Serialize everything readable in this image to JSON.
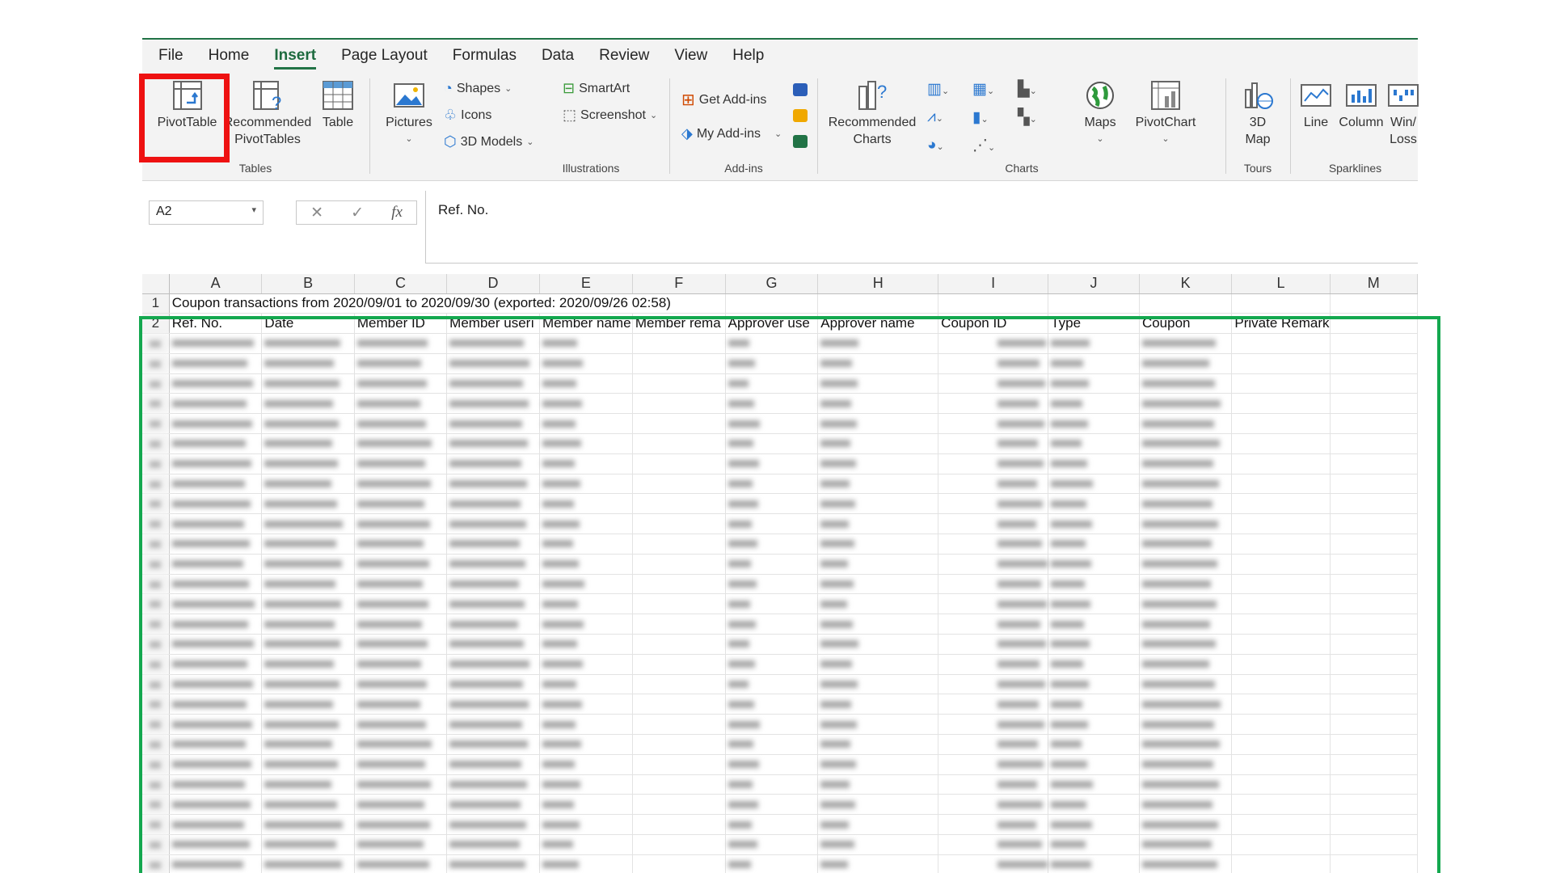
{
  "menu": [
    "File",
    "Home",
    "Insert",
    "Page Layout",
    "Formulas",
    "Data",
    "Review",
    "View",
    "Help"
  ],
  "ribbon": {
    "tables": {
      "pivottable": "PivotTable",
      "recommended_line1": "Recommended",
      "recommended_line2": "PivotTables",
      "table": "Table",
      "label": "Tables"
    },
    "illustrations": {
      "pictures": "Pictures",
      "shapes": "Shapes",
      "icons": "Icons",
      "models": "3D Models",
      "smartart": "SmartArt",
      "screenshot": "Screenshot",
      "label": "Illustrations"
    },
    "addins": {
      "get": "Get Add-ins",
      "my": "My Add-ins",
      "label": "Add-ins"
    },
    "charts": {
      "recommended_line1": "Recommended",
      "recommended_line2": "Charts",
      "maps": "Maps",
      "pivotchart": "PivotChart",
      "label": "Charts"
    },
    "tours": {
      "map_line1": "3D",
      "map_line2": "Map",
      "label": "Tours"
    },
    "sparklines": {
      "line": "Line",
      "column": "Column",
      "winloss_line1": "Win/",
      "winloss_line2": "Loss",
      "label": "Sparklines"
    }
  },
  "formula_bar": {
    "name_box": "A2",
    "fx": "fx",
    "content": "Ref. No."
  },
  "columns": [
    "A",
    "B",
    "C",
    "D",
    "E",
    "F",
    "G",
    "H",
    "I",
    "J",
    "K",
    "L",
    "M"
  ],
  "row1": "Coupon transactions from 2020/09/01 to 2020/09/30 (exported: 2020/09/26 02:58)",
  "headers": [
    "Ref. No.",
    "Date",
    "Member ID",
    "Member userı",
    "Member name",
    "Member rema",
    "Approver use",
    "Approver name",
    "Coupon ID",
    "Type",
    "Coupon",
    "Private Remark",
    ""
  ],
  "row_numbers": [
    "1",
    "2"
  ]
}
